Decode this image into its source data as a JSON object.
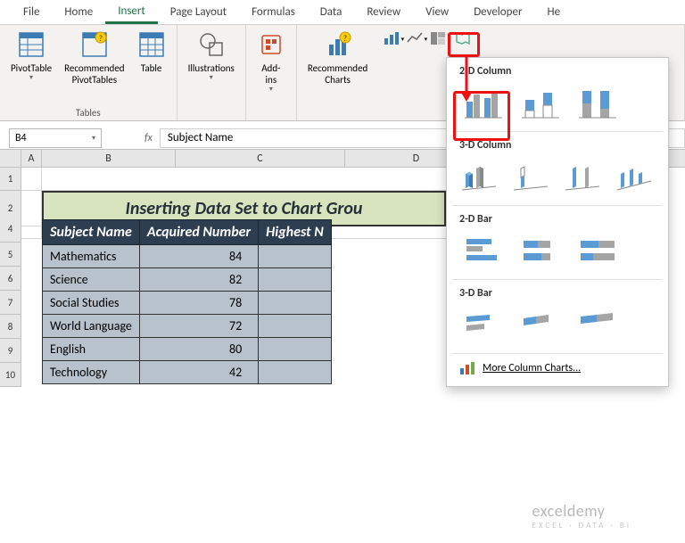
{
  "tabs": {
    "file": "File",
    "home": "Home",
    "insert": "Insert",
    "page_layout": "Page Layout",
    "formulas": "Formulas",
    "data": "Data",
    "review": "Review",
    "view": "View",
    "developer": "Developer",
    "help": "He"
  },
  "ribbon": {
    "pivot_table": "PivotTable",
    "recommended_pivot": "Recommended\nPivotTables",
    "table": "Table",
    "illustrations": "Illustrations",
    "addins": "Add-\nins",
    "recommended_charts": "Recommended\nCharts",
    "group_tables": "Tables"
  },
  "namebox": "B4",
  "formula_value": "Subject Name",
  "columns": [
    "",
    "A",
    "B",
    "C",
    "D"
  ],
  "merged_title": "Inserting Data Set to Chart Grou",
  "table": {
    "headers": [
      "Subject Name",
      "Acquired Number",
      "Highest N"
    ],
    "rows": [
      {
        "subject": "Mathematics",
        "acquired": 84
      },
      {
        "subject": "Science",
        "acquired": 82
      },
      {
        "subject": "Social Studies",
        "acquired": 78
      },
      {
        "subject": "World Language",
        "acquired": 72
      },
      {
        "subject": "English",
        "acquired": 80
      },
      {
        "subject": "Technology",
        "acquired": 42
      }
    ]
  },
  "dropdown": {
    "section1": "2-D Column",
    "section2": "3-D Column",
    "section3": "2-D Bar",
    "section4": "3-D Bar",
    "more": "More Column Charts..."
  },
  "watermark": {
    "main": "exceldemy",
    "sub": "EXCEL · DATA · BI"
  }
}
